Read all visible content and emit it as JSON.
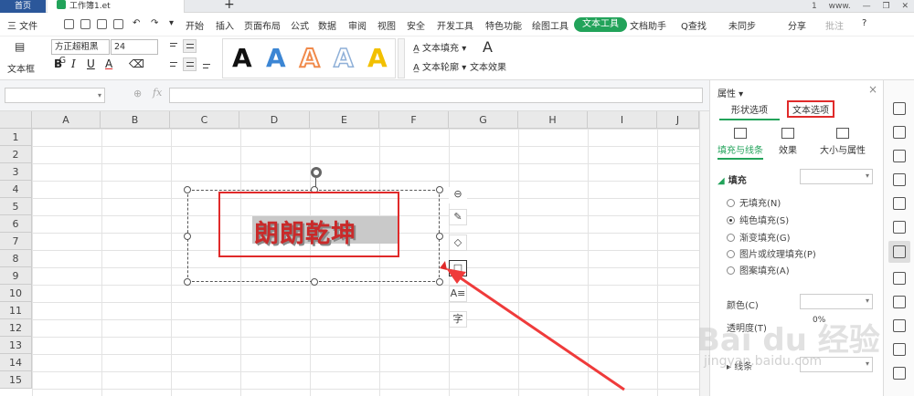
{
  "tabbar": {
    "home_tab": "首页",
    "file_tab": "工作簿1.et",
    "new_tab": "+",
    "right_items": [
      "1",
      "www."
    ]
  },
  "menubar": {
    "file_menu": "三 文件",
    "items": [
      "开始",
      "插入",
      "页面布局",
      "公式",
      "数据",
      "审阅",
      "视图",
      "安全",
      "开发工具",
      "特色功能",
      "绘图工具"
    ],
    "active_item": "文本工具",
    "items_after": [
      "文档助手"
    ],
    "search": "Q查找",
    "sync": "未同步",
    "share": "分享",
    "comment": "批注",
    "help": "?"
  },
  "ribbon": {
    "textbox_label": "文本框",
    "font_name": "方正超粗黑_G",
    "font_size": "24",
    "bold": "B",
    "italic": "I",
    "underline": "U",
    "font_color": "A",
    "style_letters": [
      {
        "letter": "A",
        "color": "#111111"
      },
      {
        "letter": "A",
        "color": "#3c86d4"
      },
      {
        "letter": "A",
        "color": "#f08a4b"
      },
      {
        "letter": "A",
        "color": "#b8cde8"
      },
      {
        "letter": "A",
        "color": "#f2c000"
      }
    ],
    "text_fill": "文本填充",
    "text_outline": "文本轮廓",
    "text_effect": "文本效果",
    "text_effect_icon": "A"
  },
  "formula_bar": {
    "fx": "fx",
    "zoom": "⊕"
  },
  "sheet": {
    "columns": [
      "A",
      "B",
      "C",
      "D",
      "E",
      "F",
      "G",
      "H",
      "I",
      "J"
    ],
    "rows": [
      "1",
      "2",
      "3",
      "4",
      "5",
      "6",
      "7",
      "8",
      "9",
      "10",
      "11",
      "12",
      "13",
      "14",
      "15"
    ],
    "wordart_text": "朗朗乾坤",
    "float_tools": [
      "⊖",
      "✎",
      "◇",
      "□",
      "A≡",
      "字"
    ]
  },
  "panel": {
    "title": "属性",
    "tab_shape": "形状选项",
    "tab_text": "文本选项",
    "subtabs": [
      "填充与线条",
      "效果",
      "大小与属性"
    ],
    "section_fill": "填充",
    "fill_options": [
      {
        "label": "无填充(N)",
        "selected": false
      },
      {
        "label": "纯色填充(S)",
        "selected": true
      },
      {
        "label": "渐变填充(G)",
        "selected": false
      },
      {
        "label": "图片或纹理填充(P)",
        "selected": false
      },
      {
        "label": "图案填充(A)",
        "selected": false
      }
    ],
    "color_label": "颜色(C)",
    "transparency_label": "透明度(T)",
    "transparency_value": "0%",
    "line_label": "线条"
  },
  "watermark": {
    "logo": "Bai du 经验",
    "url": "jingyan.baidu.com"
  },
  "colors": {
    "accent": "#22a35a",
    "highlight": "#e02a2a",
    "wordart": "#c92a2a"
  }
}
